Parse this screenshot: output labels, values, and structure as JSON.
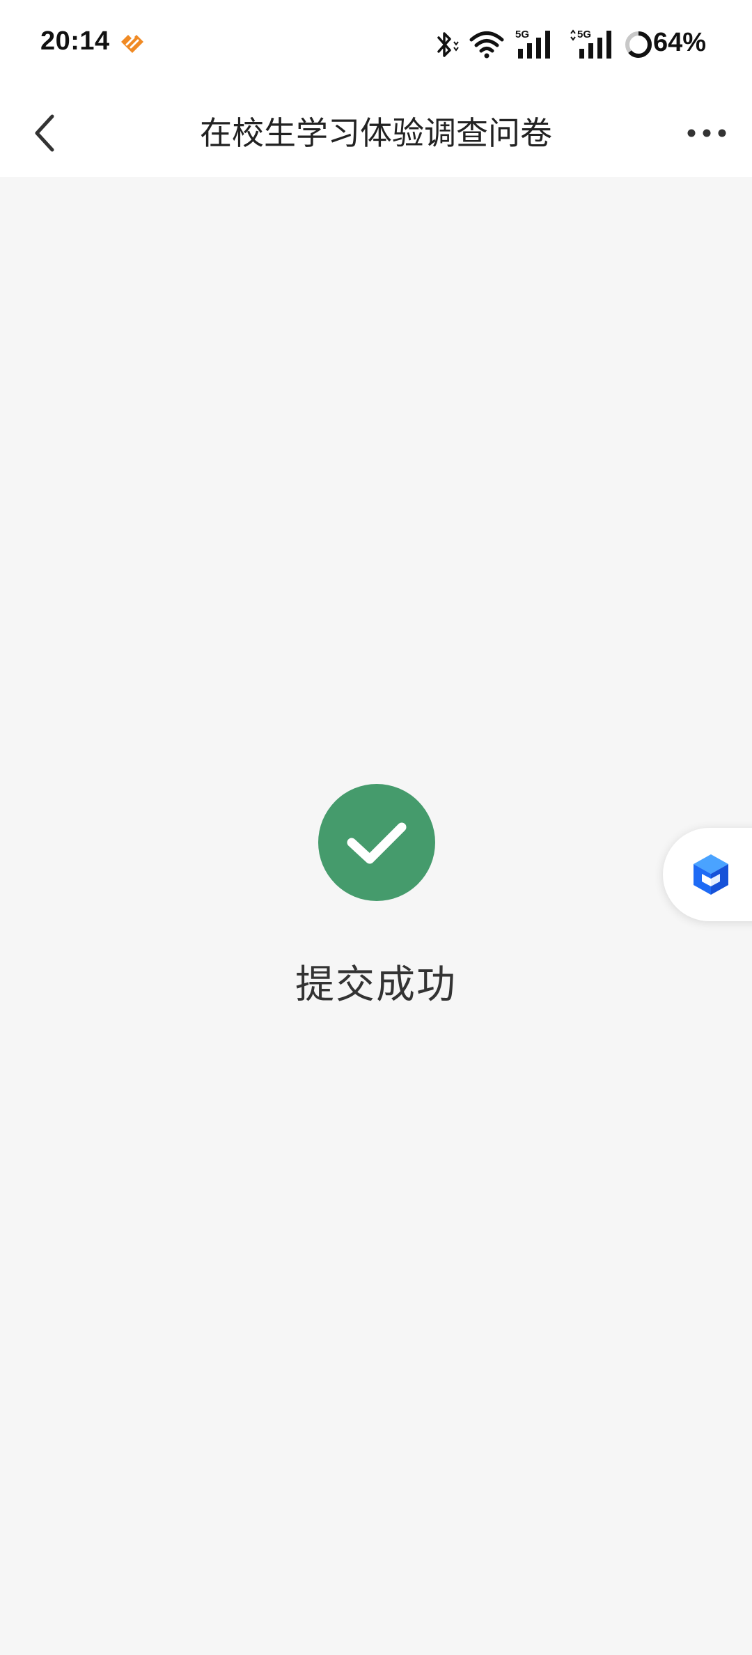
{
  "status_bar": {
    "time": "20:14",
    "battery_text": "64%",
    "icons": [
      "app-notification-icon",
      "bluetooth-icon",
      "wifi-icon",
      "5g-signal-icon",
      "5g-signal-icon",
      "battery-ring-icon"
    ],
    "battery_level": 0.64
  },
  "nav": {
    "title": "在校生学习体验调查问卷",
    "back_icon": "chevron-left-icon",
    "more_icon": "more-horizontal-icon"
  },
  "result": {
    "icon": "check-icon",
    "message": "提交成功",
    "accent_color": "#459b6c"
  },
  "floating_button": {
    "icon": "blue-cube-icon",
    "color": "#1e6bf5"
  },
  "colors": {
    "background": "#f6f6f6",
    "bar_background": "#ffffff",
    "text": "#222222",
    "app_icon": "#f08a24"
  }
}
